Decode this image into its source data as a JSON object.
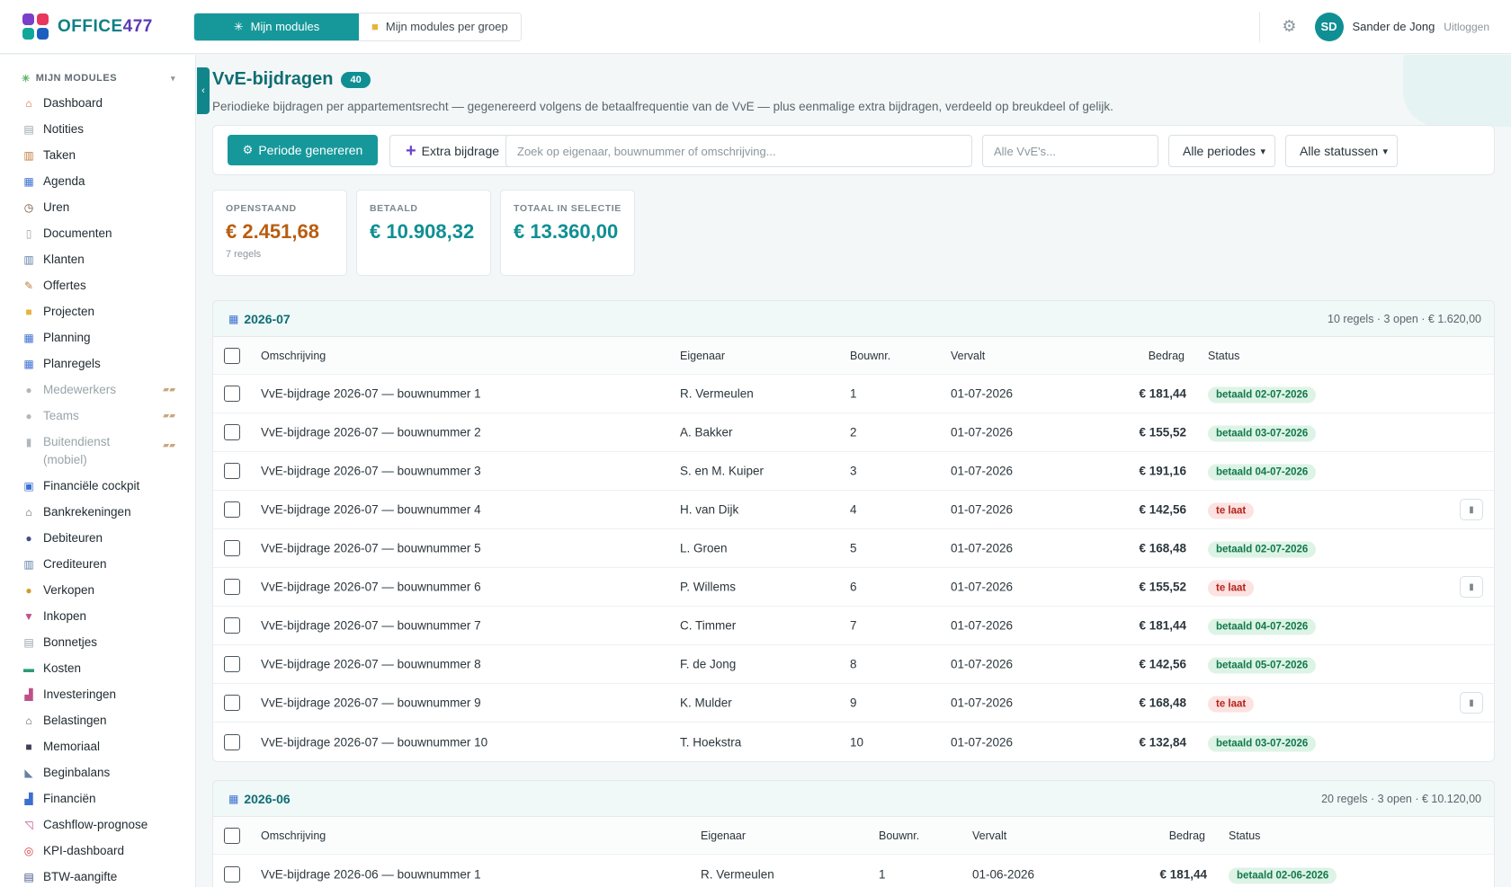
{
  "app": {
    "logo_text": "OFFICE",
    "logo_num": "477",
    "logo_colors": [
      "#7b3fc9",
      "#e8365d",
      "#11a79a",
      "#1d5fbf"
    ]
  },
  "top_tabs": [
    {
      "label": "Mijn modules",
      "icon": "puzzle-icon",
      "active": true
    },
    {
      "label": "Mijn modules per groep",
      "icon": "folder-icon",
      "active": false
    }
  ],
  "user": {
    "initials": "SD",
    "name": "Sander de Jong",
    "logout": "Uitloggen"
  },
  "sidebar": {
    "heading": "MIJN MODULES",
    "items": [
      {
        "label": "Dashboard",
        "icon": "home-icon"
      },
      {
        "label": "Notities",
        "icon": "note-icon"
      },
      {
        "label": "Taken",
        "icon": "clipboard-icon"
      },
      {
        "label": "Agenda",
        "icon": "calendar-icon"
      },
      {
        "label": "Uren",
        "icon": "clock-icon"
      },
      {
        "label": "Documenten",
        "icon": "document-icon"
      },
      {
        "label": "Klanten",
        "icon": "building-icon"
      },
      {
        "label": "Offertes",
        "icon": "pen-icon"
      },
      {
        "label": "Projecten",
        "icon": "folder-icon"
      },
      {
        "label": "Planning",
        "icon": "calendar-icon"
      },
      {
        "label": "Planregels",
        "icon": "calendar-icon"
      },
      {
        "label": "Medewerkers",
        "icon": "person-icon",
        "disabled": true
      },
      {
        "label": "Teams",
        "icon": "people-icon",
        "disabled": true
      },
      {
        "label": "Buitendienst (mobiel)",
        "icon": "phone-icon",
        "disabled": true
      },
      {
        "label": "Financiële cockpit",
        "icon": "grid-icon"
      },
      {
        "label": "Bankrekeningen",
        "icon": "bank-icon"
      },
      {
        "label": "Debiteuren",
        "icon": "people-icon"
      },
      {
        "label": "Crediteuren",
        "icon": "building-icon"
      },
      {
        "label": "Verkopen",
        "icon": "moneybag-icon"
      },
      {
        "label": "Inkopen",
        "icon": "inbox-icon"
      },
      {
        "label": "Bonnetjes",
        "icon": "receipt-icon"
      },
      {
        "label": "Kosten",
        "icon": "card-icon"
      },
      {
        "label": "Investeringen",
        "icon": "chart-icon"
      },
      {
        "label": "Belastingen",
        "icon": "bank-icon"
      },
      {
        "label": "Memoriaal",
        "icon": "book-icon"
      },
      {
        "label": "Beginbalans",
        "icon": "ruler-icon"
      },
      {
        "label": "Financiën",
        "icon": "chart-icon"
      },
      {
        "label": "Cashflow-prognose",
        "icon": "trend-icon"
      },
      {
        "label": "KPI-dashboard",
        "icon": "target-icon"
      },
      {
        "label": "BTW-aangifte",
        "icon": "receipt-icon"
      }
    ]
  },
  "page": {
    "title": "VvE-bijdragen",
    "count": "40",
    "subtitle": "Periodieke bijdragen per appartementsrecht — gegenereerd volgens de betaalfrequentie van de VvE — plus eenmalige extra bijdragen, verdeeld op breukdeel of gelijk."
  },
  "toolbar": {
    "generate_label": "Periode genereren",
    "extra_label": "Extra bijdrage",
    "search_placeholder": "Zoek op eigenaar, bouwnummer of omschrijving...",
    "vve_placeholder": "Alle VvE's...",
    "period_select": "Alle periodes",
    "status_select": "Alle statussen"
  },
  "stats": [
    {
      "label": "OPENSTAAND",
      "value": "€ 2.451,68",
      "sub": "7 regels"
    },
    {
      "label": "BETAALD",
      "value": "€ 10.908,32",
      "sub": ""
    },
    {
      "label": "TOTAAL IN SELECTIE",
      "value": "€ 13.360,00",
      "sub": ""
    }
  ],
  "columns": {
    "description": "Omschrijving",
    "owner": "Eigenaar",
    "unit": "Bouwnr.",
    "due": "Vervalt",
    "amount": "Bedrag",
    "status": "Status"
  },
  "groups": [
    {
      "title": "2026-07",
      "summary": "10 regels · 3 open · € 1.620,00",
      "rows": [
        {
          "description": "VvE-bijdrage 2026-07 — bouwnummer 1",
          "owner": "R. Vermeulen",
          "unit": "1",
          "due": "01-07-2026",
          "amount": "€ 181,44",
          "status": "betaald 02-07-2026",
          "late": false
        },
        {
          "description": "VvE-bijdrage 2026-07 — bouwnummer 2",
          "owner": "A. Bakker",
          "unit": "2",
          "due": "01-07-2026",
          "amount": "€ 155,52",
          "status": "betaald 03-07-2026",
          "late": false
        },
        {
          "description": "VvE-bijdrage 2026-07 — bouwnummer 3",
          "owner": "S. en M. Kuiper",
          "unit": "3",
          "due": "01-07-2026",
          "amount": "€ 191,16",
          "status": "betaald 04-07-2026",
          "late": false
        },
        {
          "description": "VvE-bijdrage 2026-07 — bouwnummer 4",
          "owner": "H. van Dijk",
          "unit": "4",
          "due": "01-07-2026",
          "amount": "€ 142,56",
          "status": "te laat",
          "late": true
        },
        {
          "description": "VvE-bijdrage 2026-07 — bouwnummer 5",
          "owner": "L. Groen",
          "unit": "5",
          "due": "01-07-2026",
          "amount": "€ 168,48",
          "status": "betaald 02-07-2026",
          "late": false
        },
        {
          "description": "VvE-bijdrage 2026-07 — bouwnummer 6",
          "owner": "P. Willems",
          "unit": "6",
          "due": "01-07-2026",
          "amount": "€ 155,52",
          "status": "te laat",
          "late": true
        },
        {
          "description": "VvE-bijdrage 2026-07 — bouwnummer 7",
          "owner": "C. Timmer",
          "unit": "7",
          "due": "01-07-2026",
          "amount": "€ 181,44",
          "status": "betaald 04-07-2026",
          "late": false
        },
        {
          "description": "VvE-bijdrage 2026-07 — bouwnummer 8",
          "owner": "F. de Jong",
          "unit": "8",
          "due": "01-07-2026",
          "amount": "€ 142,56",
          "status": "betaald 05-07-2026",
          "late": false
        },
        {
          "description": "VvE-bijdrage 2026-07 — bouwnummer 9",
          "owner": "K. Mulder",
          "unit": "9",
          "due": "01-07-2026",
          "amount": "€ 168,48",
          "status": "te laat",
          "late": true
        },
        {
          "description": "VvE-bijdrage 2026-07 — bouwnummer 10",
          "owner": "T. Hoekstra",
          "unit": "10",
          "due": "01-07-2026",
          "amount": "€ 132,84",
          "status": "betaald 03-07-2026",
          "late": false
        }
      ]
    },
    {
      "title": "2026-06",
      "summary": "20 regels · 3 open · € 10.120,00",
      "rows": [
        {
          "description": "VvE-bijdrage 2026-06 — bouwnummer 1",
          "owner": "R. Vermeulen",
          "unit": "1",
          "due": "01-06-2026",
          "amount": "€ 181,44",
          "status": "betaald 02-06-2026",
          "late": false
        }
      ]
    }
  ]
}
